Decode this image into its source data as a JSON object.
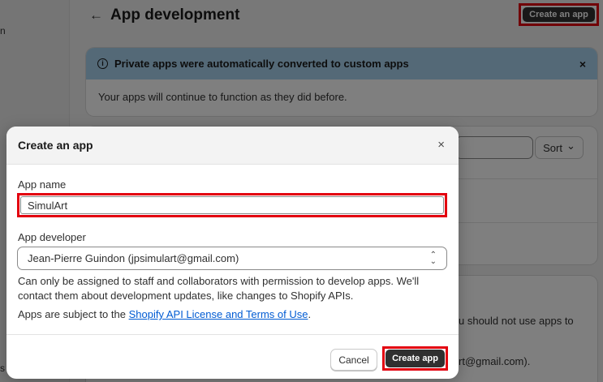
{
  "background": {
    "sidebar_fragments": [
      "n",
      "s"
    ],
    "back_arrow": "←",
    "page_title": "App development",
    "create_app_top_label": "Create an app",
    "banner": {
      "info_icon": "i",
      "title": "Private apps were automatically converted to custom apps",
      "close_icon": "×",
      "body": "Your apps will continue to function as they did before."
    },
    "sort_label": "Sort",
    "sort_chevron": "⌄",
    "partial_text_1": "u should not use apps to",
    "partial_text_2": "rt@gmail.com)."
  },
  "modal": {
    "title": "Create an app",
    "close_icon": "×",
    "app_name_label": "App name",
    "app_name_value": "SimulArt",
    "app_developer_label": "App developer",
    "app_developer_value": "Jean-Pierre Guindon (jpsimulart@gmail.com)",
    "help_text": "Can only be assigned to staff and collaborators with permission to develop apps. We'll contact them about development updates, like changes to Shopify APIs.",
    "terms_prefix": "Apps are subject to the ",
    "terms_link": "Shopify API License and Terms of Use",
    "terms_suffix": ".",
    "cancel_label": "Cancel",
    "create_label": "Create app"
  },
  "colors": {
    "banner_bg": "#a9d3ef",
    "primary_button": "#303030",
    "highlight_box": "#e3000f",
    "link": "#005bd3"
  }
}
